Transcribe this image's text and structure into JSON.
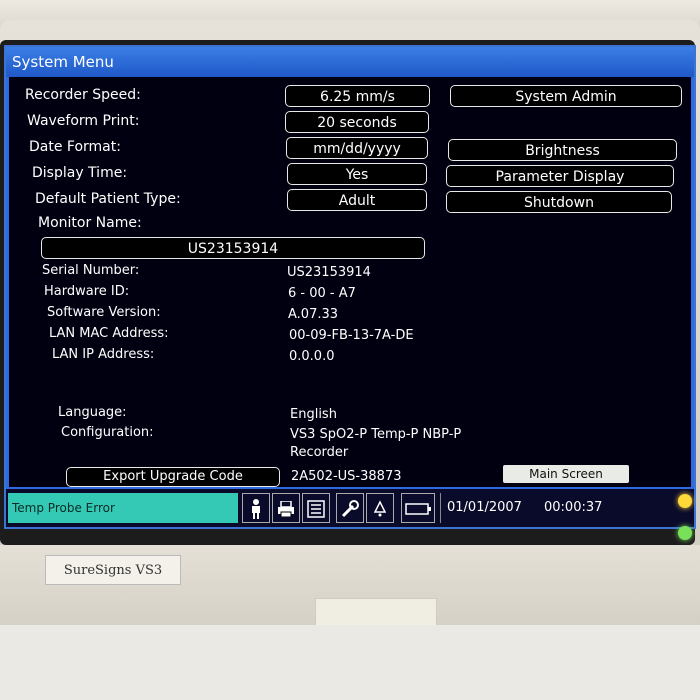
{
  "titlebar": {
    "title": "System Menu"
  },
  "settings": [
    {
      "label": "Recorder Speed:",
      "value": "6.25 mm/s"
    },
    {
      "label": "Waveform Print:",
      "value": "20 seconds"
    },
    {
      "label": "Date Format:",
      "value": "mm/dd/yyyy"
    },
    {
      "label": "Display Time:",
      "value": "Yes"
    },
    {
      "label": "Default Patient Type:",
      "value": "Adult"
    }
  ],
  "right_buttons": {
    "system_admin": "System Admin",
    "brightness": "Brightness",
    "parameter_display": "Parameter Display",
    "shutdown": "Shutdown"
  },
  "monitor_name": {
    "label": "Monitor Name:",
    "value": "US23153914"
  },
  "info": [
    {
      "label": "Serial Number:",
      "value": "US23153914"
    },
    {
      "label": "Hardware ID:",
      "value": "6 - 00 - A7"
    },
    {
      "label": "Software Version:",
      "value": "A.07.33"
    },
    {
      "label": "LAN MAC Address:",
      "value": "00-09-FB-13-7A-DE"
    },
    {
      "label": "LAN IP Address:",
      "value": "0.0.0.0"
    }
  ],
  "language": {
    "label": "Language:",
    "value": "English"
  },
  "configuration": {
    "label": "Configuration:",
    "value_line1": "VS3 SpO2-P Temp-P NBP-P",
    "value_line2": "Recorder"
  },
  "export": {
    "button": "Export Upgrade Code",
    "code": "2A502-US-38873"
  },
  "main_screen_button": "Main Screen",
  "statusbar": {
    "message": "Temp Probe Error",
    "date": "01/01/2007",
    "time": "00:00:37"
  },
  "device": {
    "brand": "SureSigns VS3"
  },
  "colors": {
    "accent": "#2f6ae0",
    "status_msg": "#33c9b5",
    "led_alarm": "#ffd83a",
    "led_power": "#79e05a"
  },
  "icons": [
    "person-icon",
    "printer-icon",
    "report-icon",
    "wrench-icon",
    "bell-icon",
    "battery-icon"
  ]
}
